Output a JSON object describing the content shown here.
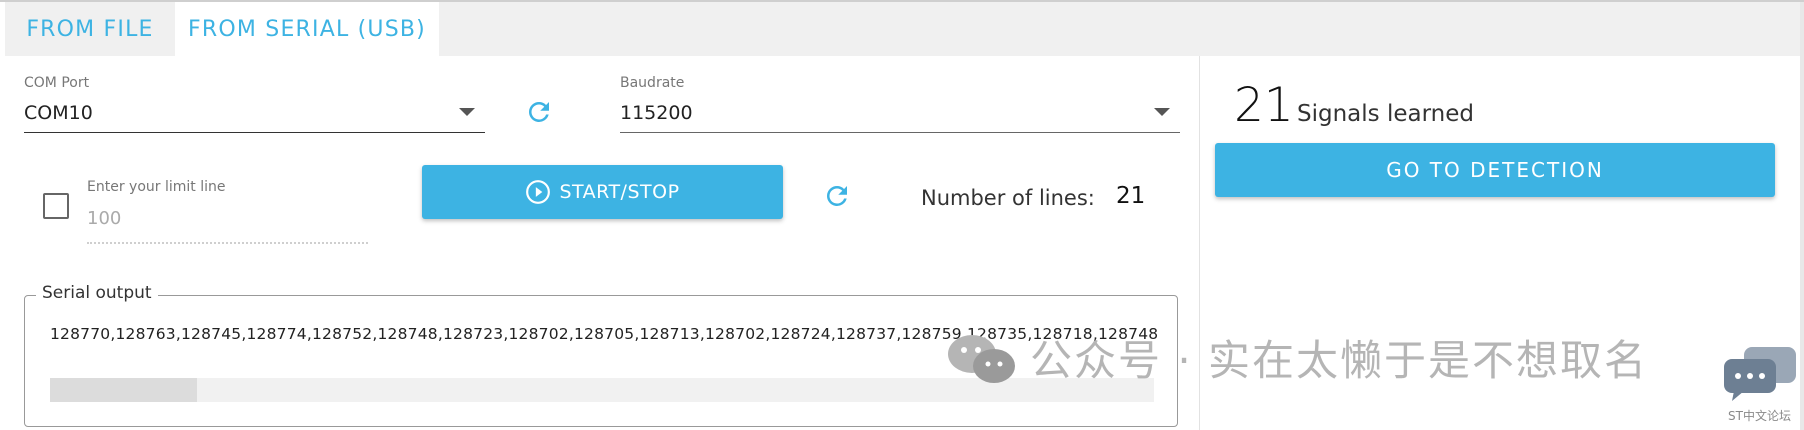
{
  "tabs": [
    {
      "label": "FROM FILE",
      "active": false
    },
    {
      "label": "FROM SERIAL (USB)",
      "active": true
    }
  ],
  "com_port": {
    "label": "COM Port",
    "value": "COM10",
    "icon": "refresh-icon"
  },
  "baudrate": {
    "label": "Baudrate",
    "value": "115200"
  },
  "limit": {
    "checked": false,
    "placeholder_label": "Enter your limit line",
    "value": "100"
  },
  "start_stop": {
    "label": "START/STOP",
    "icon": "play-circle-icon"
  },
  "lines": {
    "label": "Number of lines:",
    "value": "21",
    "icon": "refresh-icon"
  },
  "serial_output": {
    "legend": "Serial output",
    "text": "128770,128763,128745,128774,128752,128748,128723,128702,128705,128713,128702,128724,128737,128759,128735,128718,128748",
    "scroll_position": 0
  },
  "summary": {
    "count": "21",
    "label": "Signals learned"
  },
  "detection_button": {
    "label": "GO TO DETECTION"
  },
  "watermark": {
    "text": "公众号 · 实在太懒于是不想取名",
    "site": "ST中文论坛"
  },
  "colors": {
    "accent": "#3db3e3",
    "tab_bg": "#f0f0f0"
  }
}
